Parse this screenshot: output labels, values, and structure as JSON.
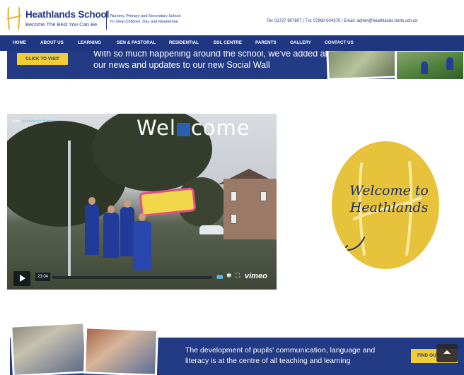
{
  "header": {
    "school_name": "Heathlands School",
    "tagline": "Become The Best You Can Be",
    "description_line1": "Nursery, Primary and Secondary School",
    "description_line2": "for Deaf Children, Day and Residential",
    "contact": "Tel: 01727 807807 | Txt: 07860 004370 | Email: admin@heathlands.herts.sch.uk"
  },
  "nav": {
    "items": [
      {
        "label": "Home"
      },
      {
        "label": "About us"
      },
      {
        "label": "Learning"
      },
      {
        "label": "SEN & Pastoral"
      },
      {
        "label": "Residential"
      },
      {
        "label": "BSL Centre"
      },
      {
        "label": "Parents"
      },
      {
        "label": "Gallery"
      },
      {
        "label": "Contact us"
      }
    ]
  },
  "social_banner": {
    "button_label": "CLICK TO VISIT",
    "text_line1": "With so much happening around the school, we've added all",
    "text_line2": "our news and updates to our new Social Wall"
  },
  "video": {
    "from_prefix": "from",
    "from_channel": "Heathlands School",
    "title_left": "Wel",
    "title_right": "come",
    "time": "23:04",
    "brand": "vimeo"
  },
  "welcome": {
    "line1": "Welcome to",
    "line2": "Heathlands"
  },
  "bottom_banner": {
    "text_line1": "The development of pupils' communication, language and",
    "text_line2": "literacy is at the centre of all teaching and learning",
    "button_label": "FIND OUT"
  },
  "colors": {
    "brand_blue": "#1f3780",
    "accent_yellow": "#f1cc34",
    "welcome_yellow": "#e7c33b"
  },
  "icons": [
    "heathlands-h-logo-icon",
    "play-icon",
    "volume-icon",
    "settings-gear-icon",
    "fullscreen-icon",
    "scroll-top-chevron-icon"
  ]
}
